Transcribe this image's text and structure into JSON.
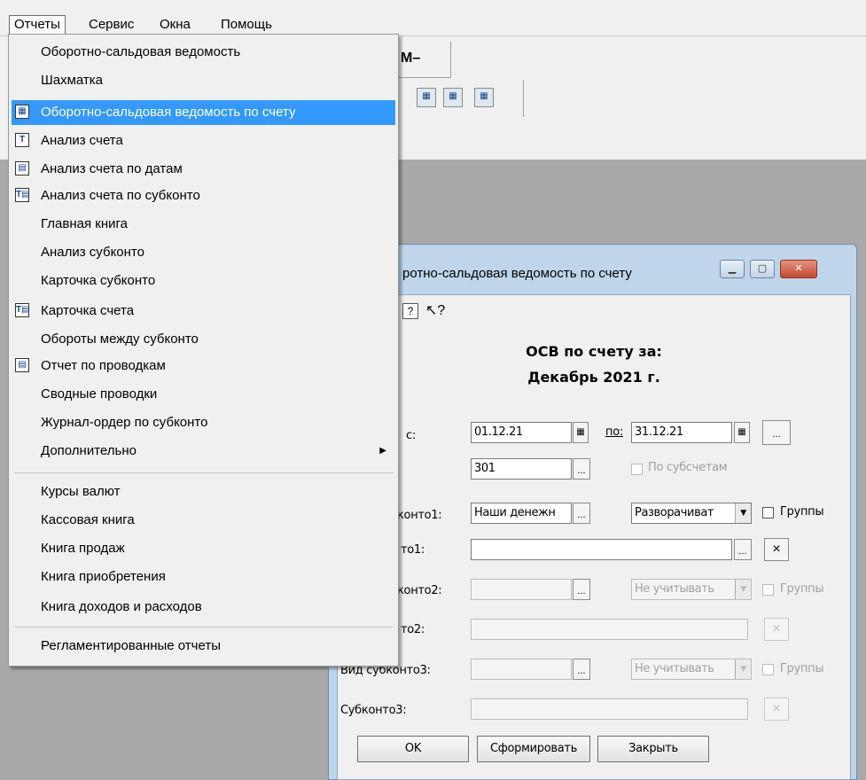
{
  "menubar": {
    "items": [
      "Отчеты",
      "Сервис",
      "Окна",
      "Помощь"
    ]
  },
  "toolbar": {
    "m_minus": "M–"
  },
  "menu": {
    "items": [
      "Оборотно-сальдовая ведомость",
      "Шахматка",
      "Оборотно-сальдовая ведомость по счету",
      "Анализ счета",
      "Анализ счета по датам",
      "Анализ счета по субконто",
      "Главная книга",
      "Анализ субконто",
      "Карточка субконто",
      "Карточка счета",
      "Обороты между субконто",
      "Отчет по проводкам",
      "Сводные проводки",
      "Журнал-ордер по субконто",
      "Дополнительно",
      "Курсы валют",
      "Кассовая книга",
      "Книга продаж",
      "Книга приобретения",
      "Книга доходов и расходов",
      "Регламентированные отчеты"
    ],
    "highlighted": "Оборотно-сальдовая ведомость по счету",
    "submenu_item": "Дополнительно"
  },
  "dialog": {
    "title": "ротно-сальдовая ведомость по счету",
    "heading1": "ОСВ по счету за:",
    "heading2": "Декабрь 2021 г.",
    "period_label": "с:",
    "date_from": "01.12.21",
    "to_label": "по:",
    "date_to": "31.12.21",
    "ellipsis": "...",
    "account": "301",
    "by_subaccounts": "По субсчетам",
    "sub1_label": "конто1:",
    "sub1_value": "Наши денежн",
    "sub1_mode": "Разворачиват",
    "groups": "Группы",
    "subconto1_label": "то1:",
    "subconto1_value": "",
    "sub2_label": "конто2:",
    "sub2_mode": "Не учитывать",
    "subconto2_label": "то2:",
    "sub3_label": "Вид субконто3:",
    "sub3_mode": "Не учитывать",
    "subconto3_label": "Субконто3:",
    "x": "×",
    "ok": "OK",
    "build": "Сформировать",
    "close": "Закрыть"
  }
}
